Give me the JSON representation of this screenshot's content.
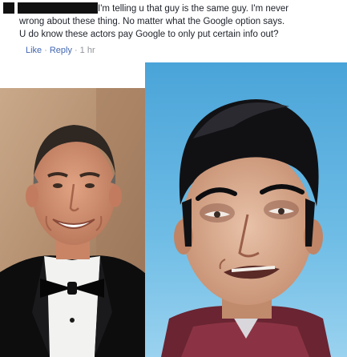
{
  "comment": {
    "text_line1": "I'm telling u that guy is the same guy. I'm never",
    "text_line2": "wrong about these thing. No matter what the Google option says.",
    "text_line3": "U do know these actors pay Google to only put certain info out?",
    "like_label": "Like",
    "reply_label": "Reply",
    "timestamp": "1 hr"
  },
  "colors": {
    "link": "#4267b2",
    "meta_gray": "#90949c",
    "text": "#1d2129"
  }
}
